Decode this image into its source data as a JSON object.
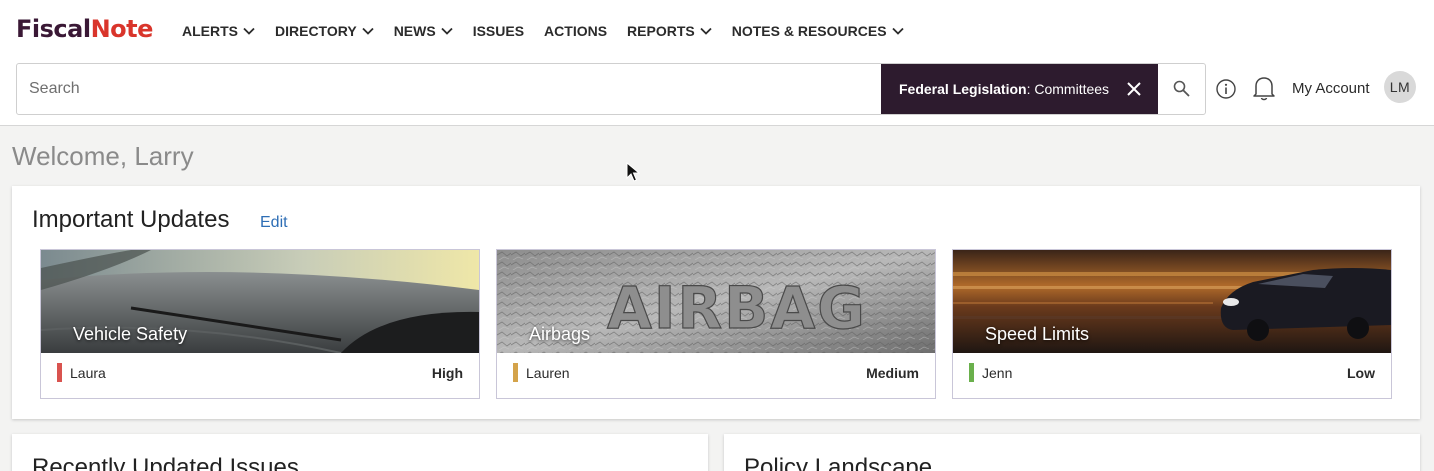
{
  "logo": {
    "part1": "Fiscal",
    "part2": "Note"
  },
  "nav": [
    {
      "label": "ALERTS",
      "dropdown": true
    },
    {
      "label": "DIRECTORY",
      "dropdown": true
    },
    {
      "label": "NEWS",
      "dropdown": true
    },
    {
      "label": "ISSUES",
      "dropdown": false
    },
    {
      "label": "ACTIONS",
      "dropdown": false
    },
    {
      "label": "REPORTS",
      "dropdown": true
    },
    {
      "label": "NOTES & RESOURCES",
      "dropdown": true
    }
  ],
  "search": {
    "placeholder": "Search",
    "value": "",
    "filter": {
      "category": "Federal Legislation",
      "separator": ": ",
      "value": "Committees"
    }
  },
  "header": {
    "account_label": "My Account",
    "avatar_initials": "LM"
  },
  "welcome": "Welcome, Larry",
  "updates": {
    "title": "Important Updates",
    "edit_label": "Edit",
    "cards": [
      {
        "title": "Vehicle Safety",
        "owner": "Laura",
        "priority": "High",
        "priority_color": "#d9534f",
        "image": "windshield-road"
      },
      {
        "title": "Airbags",
        "owner": "Lauren",
        "priority": "Medium",
        "priority_color": "#d4a34a",
        "image": "airbag-embossed"
      },
      {
        "title": "Speed Limits",
        "owner": "Jenn",
        "priority": "Low",
        "priority_color": "#6ab04c",
        "image": "speeding-car"
      }
    ]
  },
  "recent": {
    "title": "Recently Updated Issues"
  },
  "policy": {
    "title": "Policy Landscape"
  },
  "colors": {
    "brand_dark": "#3a1835",
    "brand_red": "#d9352b",
    "chip_bg": "#2d1b2e",
    "link": "#2e6eb5"
  }
}
